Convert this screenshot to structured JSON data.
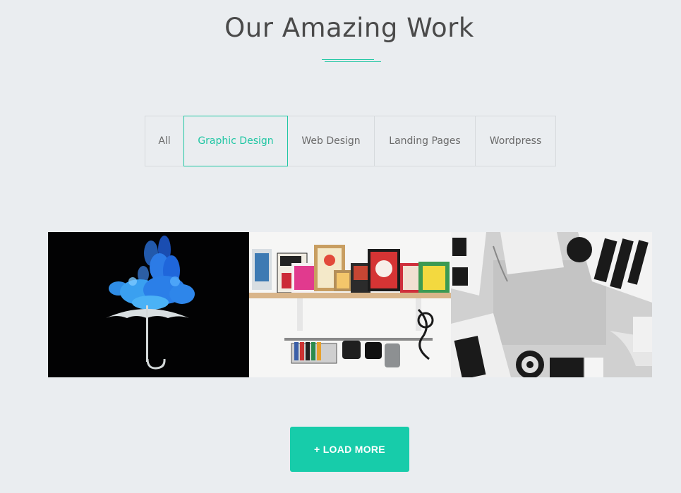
{
  "section": {
    "title": "Our Amazing Work",
    "accent_color": "#1fc6a3"
  },
  "filters": [
    {
      "label": "All",
      "active": false
    },
    {
      "label": "Graphic Design",
      "active": true
    },
    {
      "label": "Web Design",
      "active": false
    },
    {
      "label": "Landing Pages",
      "active": false
    },
    {
      "label": "Wordpress",
      "active": false
    }
  ],
  "gallery": [
    {
      "subject": "blue smoke umbrella on black"
    },
    {
      "subject": "shelf of framed posters and art supplies"
    },
    {
      "subject": "grayscale desk with typography posters"
    }
  ],
  "load_more": {
    "label": "+ LOAD MORE",
    "color": "#17ccaa"
  }
}
